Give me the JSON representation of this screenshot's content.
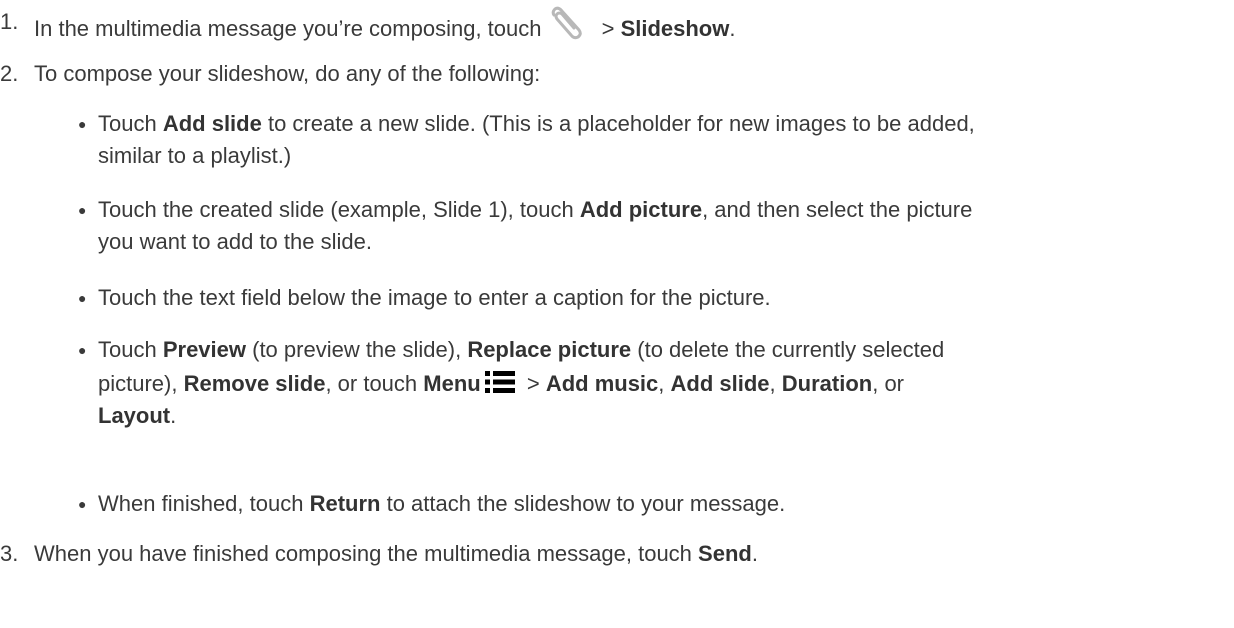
{
  "steps": [
    {
      "num": "1.",
      "before": "In the multimedia message you’re composing, touch",
      "after_icon": " > ",
      "bold": "Slideshow",
      "end": ".",
      "icon": "paperclip-icon"
    },
    {
      "num": "2.",
      "text": "To compose your slideshow, do any of the following:"
    },
    {
      "num": "3.",
      "before": "When you have finished composing the multimedia message, touch ",
      "bold": "Send",
      "end": "."
    }
  ],
  "bullets": [
    {
      "b1_pre": "Touch ",
      "b1_bold": "Add slide",
      "b1_line1_rest": " to create a new slide. (This is a placeholder for new images to be added,",
      "b1_line2": "similar to a playlist.)"
    },
    {
      "b2_pre": "Touch the created slide (example, Slide 1), touch ",
      "b2_bold": "Add picture",
      "b2_line1_rest": ", and then select the picture",
      "b2_line2": "you want to add to the slide."
    },
    {
      "b3_text": "Touch the text field below the image to enter a caption for the picture."
    },
    {
      "b4_pre": "Touch ",
      "b4_bold1": "Preview",
      "b4_mid1": " (to preview the slide), ",
      "b4_bold2": "Replace picture",
      "b4_line1_rest": " (to delete the currently selected",
      "b4_line2_pre": "picture), ",
      "b4_bold3": "Remove slide",
      "b4_mid2": ", or touch ",
      "b4_bold4": "Menu",
      "b4_gt": " > ",
      "b4_bold5": "Add music",
      "b4_comma1": ", ",
      "b4_bold6": "Add slide",
      "b4_comma2": ", ",
      "b4_bold7": "Duration",
      "b4_or": ", or",
      "b4_bold8": "Layout",
      "b4_end": ".",
      "icon": "menu-icon"
    },
    {
      "b5_pre": "When finished, touch ",
      "b5_bold": "Return",
      "b5_rest": " to attach the slideshow to your message."
    }
  ],
  "bullet_char": "●"
}
